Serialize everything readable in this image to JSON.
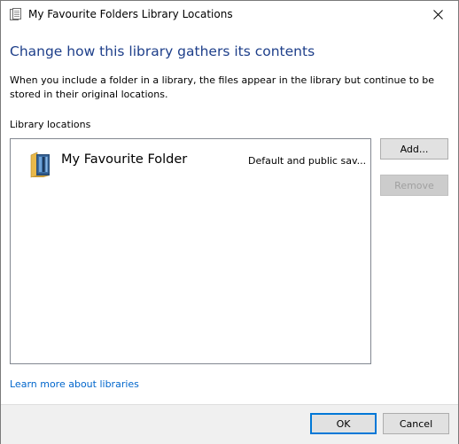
{
  "window": {
    "title": "My Favourite Folders Library Locations",
    "title_icon": "library-icon",
    "close_icon": "close-icon"
  },
  "main": {
    "heading": "Change how this library gathers its contents",
    "description": "When you include a folder in a library, the files appear in the library but continue to be stored in their original locations.",
    "locations_label": "Library locations",
    "locations": [
      {
        "name": "My Favourite Folder",
        "type": "Default and public sav...",
        "icon": "library-folder-icon"
      }
    ],
    "add_label": "Add...",
    "remove_label": "Remove",
    "learn_more_link": "Learn more about libraries"
  },
  "footer": {
    "ok_label": "OK",
    "cancel_label": "Cancel"
  },
  "colors": {
    "heading": "#1e3f8a",
    "link": "#0066cc",
    "default_button_border": "#0078d7",
    "footer_background": "#f0f0f0"
  }
}
